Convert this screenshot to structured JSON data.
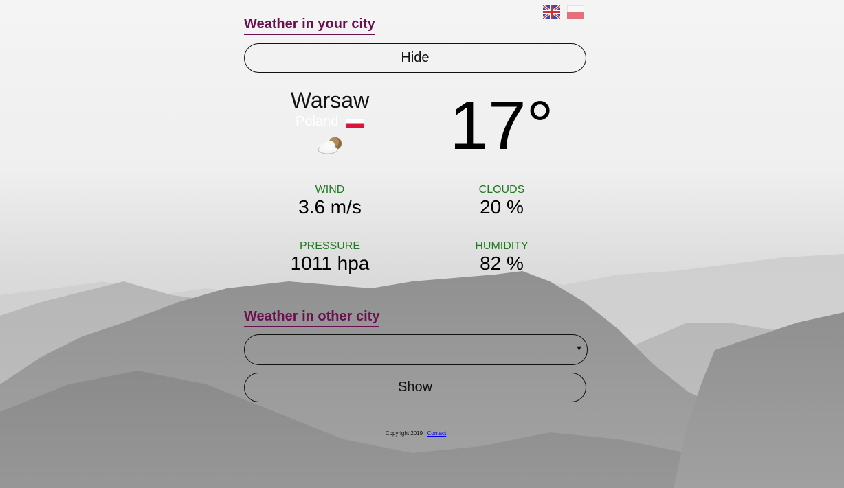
{
  "languages": [
    {
      "code": "en",
      "icon": "uk-flag-icon"
    },
    {
      "code": "pl",
      "icon": "poland-flag-icon"
    }
  ],
  "current": {
    "section_title": "Weather in your city",
    "toggle_label": "Hide",
    "city": "Warsaw",
    "country": "Poland",
    "condition_icon": "partly-cloudy-icon",
    "temperature": "17°",
    "stats": {
      "wind_label": "WIND",
      "wind_value": "3.6 m/s",
      "clouds_label": "CLOUDS",
      "clouds_value": "20 %",
      "pressure_label": "PRESSURE",
      "pressure_value": "1011 hpa",
      "humidity_label": "HUMIDITY",
      "humidity_value": "82 %"
    }
  },
  "other": {
    "section_title": "Weather in other city",
    "select_value": "",
    "show_label": "Show"
  },
  "footer": {
    "copyright": "Copyright 2019 | ",
    "contact_link": "Contact"
  },
  "colors": {
    "accent": "#6a0f4f",
    "label_green": "#1f7a1f",
    "poland_red": "#dc143c"
  }
}
